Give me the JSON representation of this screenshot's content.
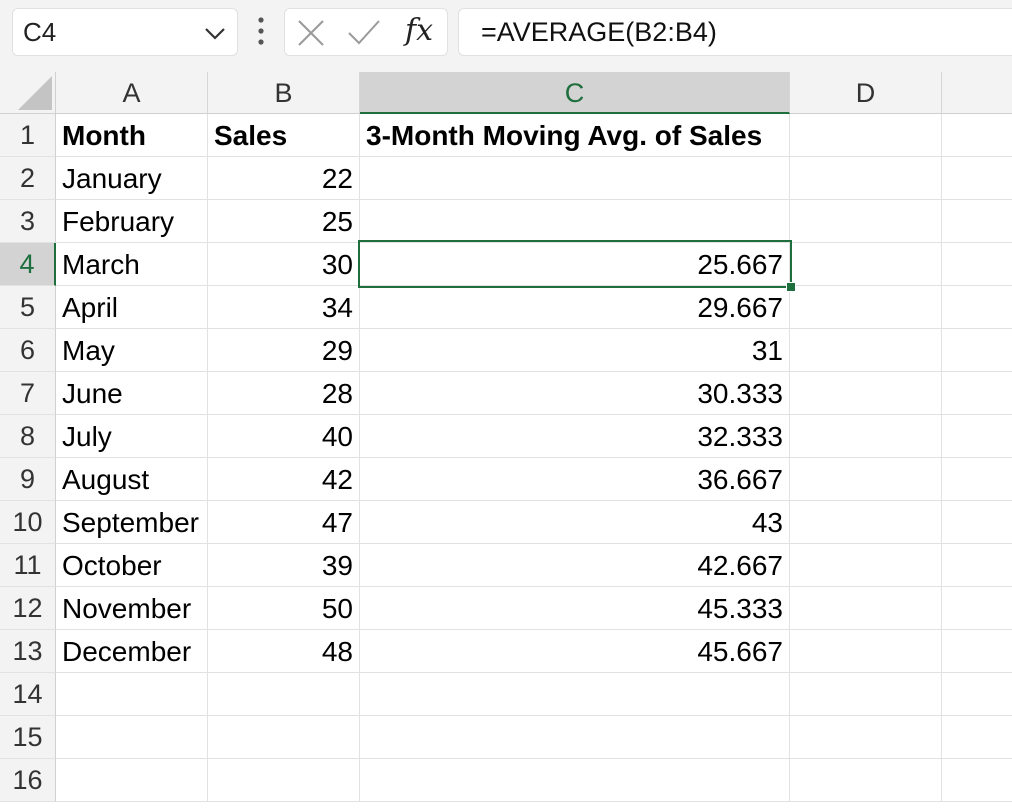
{
  "name_box": "C4",
  "formula_bar": {
    "formula": "=AVERAGE(B2:B4)",
    "fx_label": "fx"
  },
  "columns": [
    "A",
    "B",
    "C",
    "D"
  ],
  "selected_column": "C",
  "selected_row": "4",
  "rows": [
    {
      "num": "1",
      "a": "Month",
      "b": "Sales",
      "c": "3-Month Moving Avg. of Sales"
    },
    {
      "num": "2",
      "a": "January",
      "b": "22",
      "c": ""
    },
    {
      "num": "3",
      "a": "February",
      "b": "25",
      "c": ""
    },
    {
      "num": "4",
      "a": "March",
      "b": "30",
      "c": "25.667"
    },
    {
      "num": "5",
      "a": "April",
      "b": "34",
      "c": "29.667"
    },
    {
      "num": "6",
      "a": "May",
      "b": "29",
      "c": "31"
    },
    {
      "num": "7",
      "a": "June",
      "b": "28",
      "c": "30.333"
    },
    {
      "num": "8",
      "a": "July",
      "b": "40",
      "c": "32.333"
    },
    {
      "num": "9",
      "a": "August",
      "b": "42",
      "c": "36.667"
    },
    {
      "num": "10",
      "a": "September",
      "b": "47",
      "c": "43"
    },
    {
      "num": "11",
      "a": "October",
      "b": "39",
      "c": "42.667"
    },
    {
      "num": "12",
      "a": "November",
      "b": "50",
      "c": "45.333"
    },
    {
      "num": "13",
      "a": "December",
      "b": "48",
      "c": "45.667"
    },
    {
      "num": "14",
      "a": "",
      "b": "",
      "c": ""
    },
    {
      "num": "15",
      "a": "",
      "b": "",
      "c": ""
    },
    {
      "num": "16",
      "a": "",
      "b": "",
      "c": ""
    }
  ],
  "icons": {
    "name_box_dropdown": "chevron-down-icon",
    "more": "vertical-dots-icon",
    "cancel": "cancel-x-icon",
    "enter": "checkmark-icon",
    "insert_function": "fx-icon",
    "select_all": "select-all-triangle-icon"
  },
  "colors": {
    "accent": "#1e6e3e",
    "header_bg": "#f3f3f3",
    "selected_header_bg": "#d3d3d3"
  }
}
